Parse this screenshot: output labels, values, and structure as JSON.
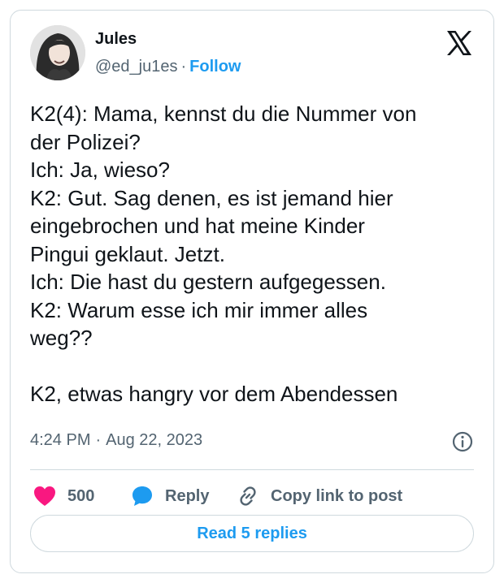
{
  "author": {
    "name": "Jules",
    "handle": "@ed_ju1es",
    "separator": "·",
    "follow_label": "Follow"
  },
  "tweet": {
    "lines": [
      "K2(4): Mama, kennst du die Nummer von",
      "der Polizei?",
      "Ich: Ja, wieso?",
      "K2: Gut. Sag denen, es ist jemand hier",
      "eingebrochen und hat meine Kinder",
      "Pingui geklaut. Jetzt.",
      "Ich: Die hast du gestern aufgegessen.",
      "K2: Warum esse ich mir immer alles",
      "weg??",
      "",
      "K2, etwas hangry vor dem Abendessen"
    ],
    "time": "4:24 PM",
    "separator": "·",
    "date": "Aug 22, 2023"
  },
  "actions": {
    "like_count": "500",
    "reply_label": "Reply",
    "copy_label": "Copy link to post"
  },
  "read_replies_label": "Read 5 replies",
  "icons": {
    "logo": "x-logo-icon",
    "info": "info-icon",
    "like": "heart-icon",
    "reply": "speech-bubble-icon",
    "copy": "link-icon"
  },
  "colors": {
    "accent": "#1d9bf0",
    "like": "#f91880",
    "text": "#0f1419",
    "secondary": "#536471",
    "border": "#cfd9de"
  }
}
